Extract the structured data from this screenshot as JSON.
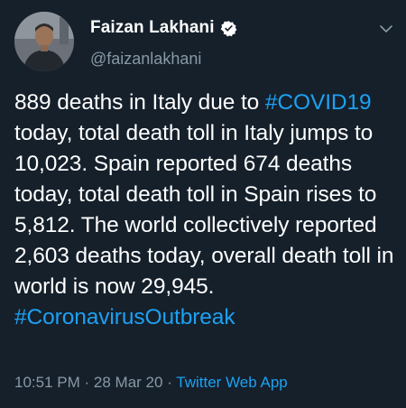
{
  "user": {
    "display_name": "Faizan Lakhani",
    "handle": "@faizanlakhani",
    "verified": true
  },
  "tweet": {
    "segments": [
      {
        "text": "889 deaths in Italy due to ",
        "type": "text"
      },
      {
        "text": "#COVID19",
        "type": "hashtag"
      },
      {
        "text": " today, total death toll in Italy jumps to 10,023. Spain reported 674 deaths today, total death toll in Spain rises to 5,812. The world collectively reported 2,603 deaths today, overall death toll in world is now 29,945. ",
        "type": "text"
      },
      {
        "text": "#CoronavirusOutbreak",
        "type": "hashtag"
      }
    ],
    "time": "10:51 PM",
    "separator": "·",
    "date": "28 Mar 20",
    "source": "Twitter Web App"
  },
  "colors": {
    "background": "#15202b",
    "accent": "#1da1f2",
    "muted": "#8899a6",
    "text": "#ffffff"
  },
  "icons": [
    "verified-icon",
    "chevron-down-icon"
  ]
}
